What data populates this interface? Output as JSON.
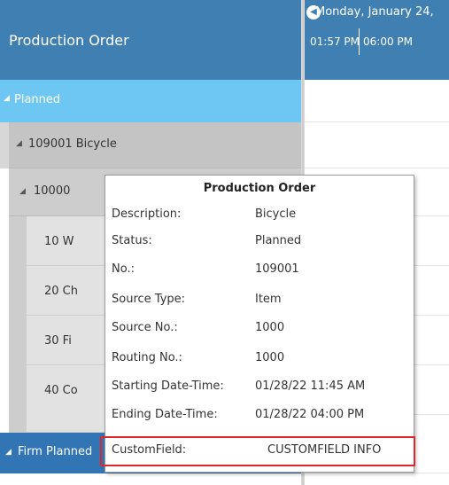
{
  "left_panel": {
    "header_title": "Production Order",
    "groups": [
      {
        "label": "Planned"
      },
      {
        "label": "Firm Planned"
      }
    ],
    "order": {
      "label": "109001 Bicycle"
    },
    "routing": {
      "label": "10000"
    },
    "operations": [
      {
        "label": "10 W"
      },
      {
        "label": "20 Ch"
      },
      {
        "label": "30 Fi"
      },
      {
        "label": "40 Co"
      }
    ]
  },
  "timeline": {
    "date_label": "Monday, January 24,",
    "times": [
      "01:57 PM",
      "06:00 PM"
    ]
  },
  "tooltip": {
    "title": "Production Order",
    "rows": [
      {
        "key": "Description:",
        "value": "Bicycle"
      },
      {
        "key": "Status:",
        "value": "Planned"
      },
      {
        "key": "No.:",
        "value": "109001"
      },
      {
        "key": "Source Type:",
        "value": "Item"
      },
      {
        "key": "Source No.:",
        "value": "1000"
      },
      {
        "key": "Routing No.:",
        "value": "1000"
      },
      {
        "key": "Starting Date-Time:",
        "value": "01/28/22 11:45 AM"
      },
      {
        "key": "Ending Date-Time:",
        "value": "01/28/22 04:00 PM"
      },
      {
        "key": "CustomField:",
        "value": "CUSTOMFIELD INFO"
      }
    ],
    "highlight_color": "#e0262b"
  },
  "colors": {
    "header_bg": "#3f7fb2",
    "planned_bg": "#6ec6f2",
    "firm_bg": "#3175b5"
  }
}
